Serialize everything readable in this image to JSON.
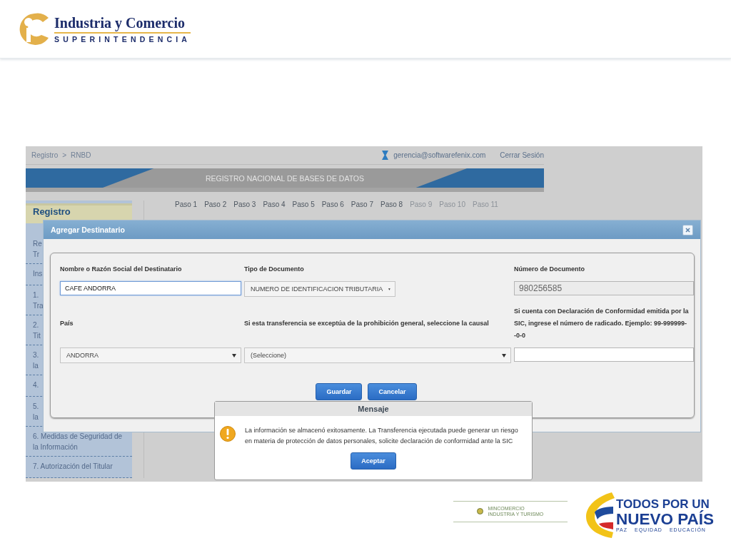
{
  "slide_header": {
    "logo_title": "Industria y Comercio",
    "logo_subtitle": "SUPERINTENDENCIA"
  },
  "app": {
    "breadcrumb": [
      "Registro",
      "RNBD"
    ],
    "breadcrumb_separator": ">",
    "user_email": "gerencia@softwarefenix.com",
    "logout": "Cerrar Sesión",
    "banner_title": "REGISTRO NACIONAL DE BASES DE DATOS",
    "sidebar": {
      "title": "Registro",
      "items": [
        {
          "lines": [
            "Re",
            "Tr"
          ]
        },
        {
          "lines": [
            "Ins"
          ]
        },
        {
          "lines": [
            "1.",
            "Tra"
          ]
        },
        {
          "lines": [
            "2.",
            "Tit"
          ]
        },
        {
          "lines": [
            "3.",
            "la"
          ]
        },
        {
          "lines": [
            "4."
          ]
        },
        {
          "lines": [
            "5.",
            "la"
          ]
        },
        {
          "lines": [
            "6. Medidas de Seguridad de",
            "la Información"
          ]
        },
        {
          "lines": [
            "7. Autorización del Titular"
          ]
        }
      ]
    },
    "steps": [
      {
        "label": "Paso 1",
        "enabled": true
      },
      {
        "label": "Paso 2",
        "enabled": true
      },
      {
        "label": "Paso 3",
        "enabled": true
      },
      {
        "label": "Paso 4",
        "enabled": true
      },
      {
        "label": "Paso 5",
        "enabled": true
      },
      {
        "label": "Paso 6",
        "enabled": true
      },
      {
        "label": "Paso 7",
        "enabled": true
      },
      {
        "label": "Paso 8",
        "enabled": true
      },
      {
        "label": "Paso 9",
        "enabled": false
      },
      {
        "label": "Paso 10",
        "enabled": false
      },
      {
        "label": "Paso 11",
        "enabled": false
      }
    ]
  },
  "dialog": {
    "title": "Agregar Destinatario",
    "fields": [
      {
        "kind": "text",
        "label": "Nombre o Razón Social del Destinatario",
        "value": "CAFE ANDORRA",
        "focused": true,
        "disabled": false
      },
      {
        "kind": "select",
        "label": "Tipo de Documento",
        "value": "NUMERO DE IDENTIFICACION TRIBUTARIA"
      },
      {
        "kind": "text",
        "label": "Número de Documento",
        "value": "980256585",
        "focused": false,
        "disabled": true
      },
      {
        "kind": "select",
        "label": "País",
        "value": "ANDORRA"
      },
      {
        "kind": "select",
        "label": "Si esta transferencia se exceptúa de la prohibición general, seleccione la causal",
        "value": "(Seleccione)"
      },
      {
        "kind": "text",
        "label": "Si cuenta con Declaración de Conformidad emitida por la SIC, ingrese el número de radicado. Ejemplo: 99-999999--0-0",
        "focused": false,
        "disabled": false
      }
    ],
    "buttons": [
      "Guardar",
      "Cancelar"
    ]
  },
  "message": {
    "title": "Mensaje",
    "text": "La información se almacenó exitosamente. La Transferencia ejecutada puede generar un riesgo en materia de protección de datos personales, solicite declaración de conformidad ante la SIC",
    "button": "Aceptar"
  },
  "footer": {
    "ministry_lines": [
      "MINCOMERCIO",
      "INDUSTRIA Y TURISMO"
    ],
    "slogan_top": "TODOS POR UN",
    "slogan_main": "NUEVO PAÍS",
    "slogan_words": [
      "PAZ",
      "EQUIDAD",
      "EDUCACIÓN"
    ]
  }
}
